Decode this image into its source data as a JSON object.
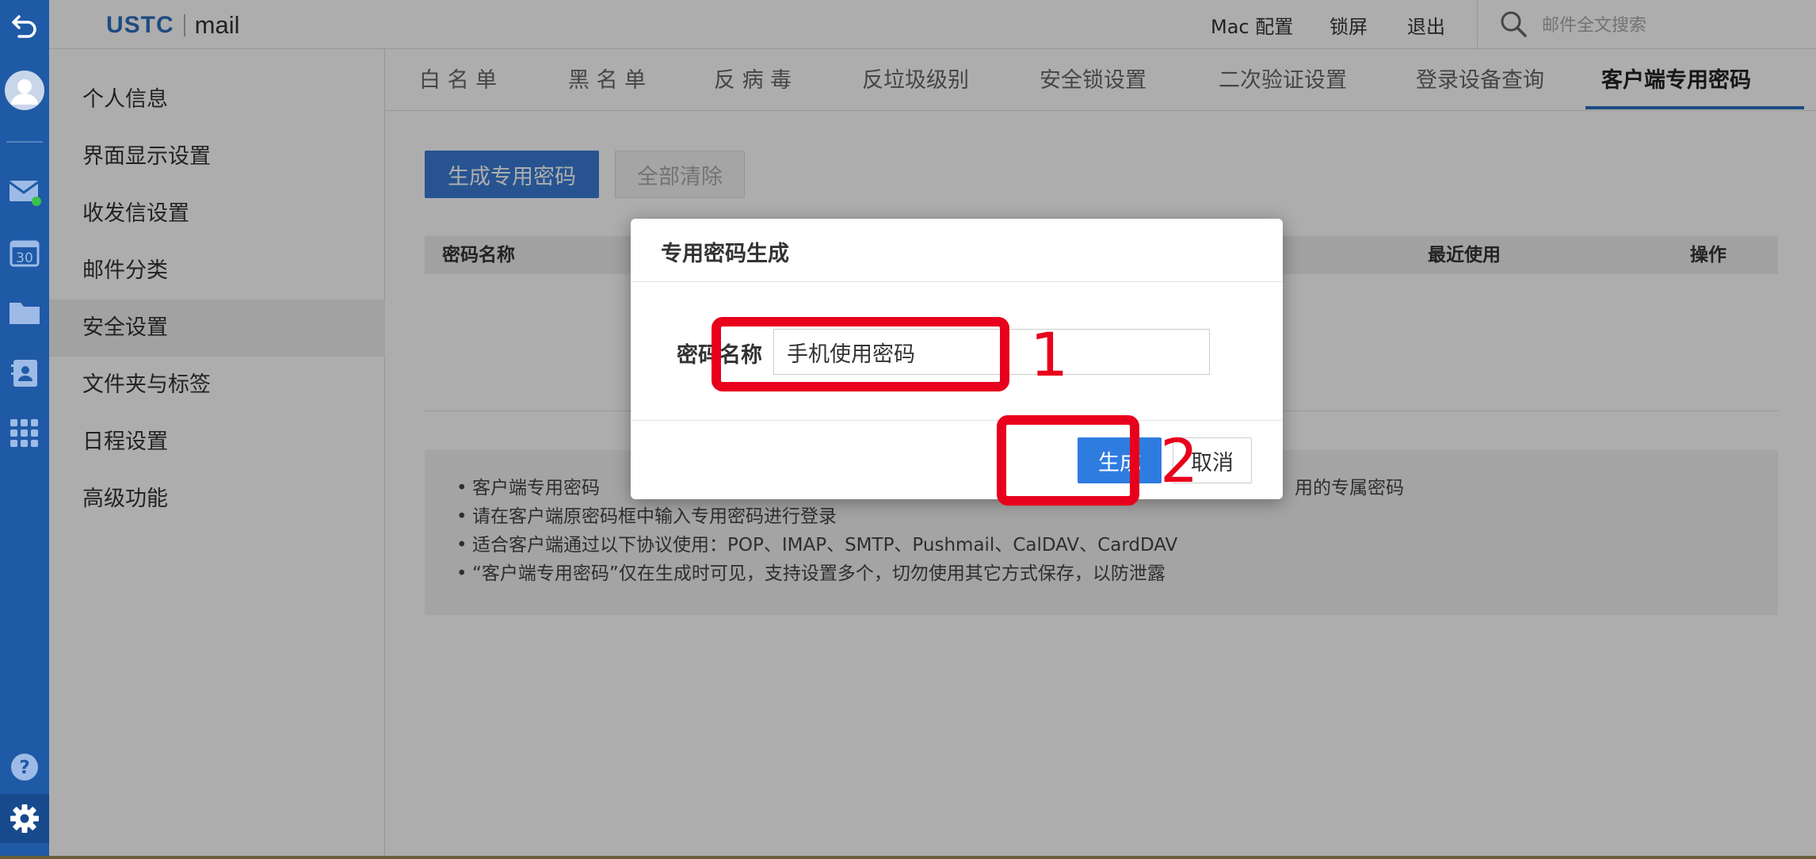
{
  "header": {
    "logo_ustc": "USTC",
    "logo_mail": "mail",
    "links": [
      "Mac 配置",
      "锁屏",
      "退出"
    ],
    "search_placeholder": "邮件全文搜索"
  },
  "side_menu": {
    "items": [
      "个人信息",
      "界面显示设置",
      "收发信设置",
      "邮件分类",
      "安全设置",
      "文件夹与标签",
      "日程设置",
      "高级功能"
    ],
    "active": "安全设置"
  },
  "tabs": {
    "items": [
      "白 名 单",
      "黑 名 单",
      "反 病 毒",
      "反垃圾级别",
      "安全锁设置",
      "二次验证设置",
      "登录设备查询",
      "客户端专用密码"
    ],
    "active": "客户端专用密码"
  },
  "toolbar": {
    "generate_label": "生成专用密码",
    "clear_label": "全部清除"
  },
  "table": {
    "columns": [
      "密码名称",
      "最近使用",
      "操作"
    ]
  },
  "notice": {
    "lines": [
      "客户端专用密码",
      "用的专属密码",
      "请在客户端原密码框中输入专用密码进行登录",
      "适合客户端通过以下协议使用：POP、IMAP、SMTP、Pushmail、CalDAV、CardDAV",
      "“客户端专用密码”仅在生成时可见，支持设置多个，切勿使用其它方式保存，以防泄露"
    ]
  },
  "dialog": {
    "title": "专用密码生成",
    "field_label": "密码名称",
    "field_value": "手机使用密码",
    "confirm_label": "生成",
    "cancel_label": "取消"
  },
  "annotations": {
    "step1": "1",
    "step2": "2",
    "color": "#e8001c"
  },
  "colors": {
    "rail": "#1f5aa6",
    "accent": "#2f7ce0"
  }
}
